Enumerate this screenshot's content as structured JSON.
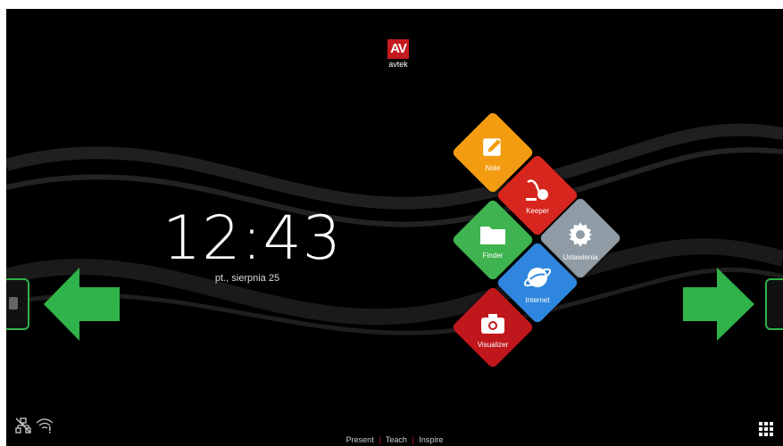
{
  "brand": {
    "logo_text": "AV",
    "word": "avtek"
  },
  "clock": {
    "time": "12:43",
    "date": "pt., sierpnia 25"
  },
  "apps": [
    {
      "label": "Note",
      "icon": "pencil-icon",
      "color": "#f39c12"
    },
    {
      "label": "Keeper",
      "icon": "vacuum-icon",
      "color": "#d7261e"
    },
    {
      "label": "Finder",
      "icon": "folder-icon",
      "color": "#3fb34f"
    },
    {
      "label": "Ustawienia",
      "icon": "gear-icon",
      "color": "#8f9ba5"
    },
    {
      "label": "Internet",
      "icon": "planet-icon",
      "color": "#2e86de"
    },
    {
      "label": "Visualizer",
      "icon": "camera-icon",
      "color": "#c0171c"
    }
  ],
  "footer": {
    "present": "Present",
    "teach": "Teach",
    "inspire": "Inspire",
    "sep": "|"
  },
  "colors": {
    "arrow": "#2fb34a",
    "accent": "#c41a1f"
  }
}
